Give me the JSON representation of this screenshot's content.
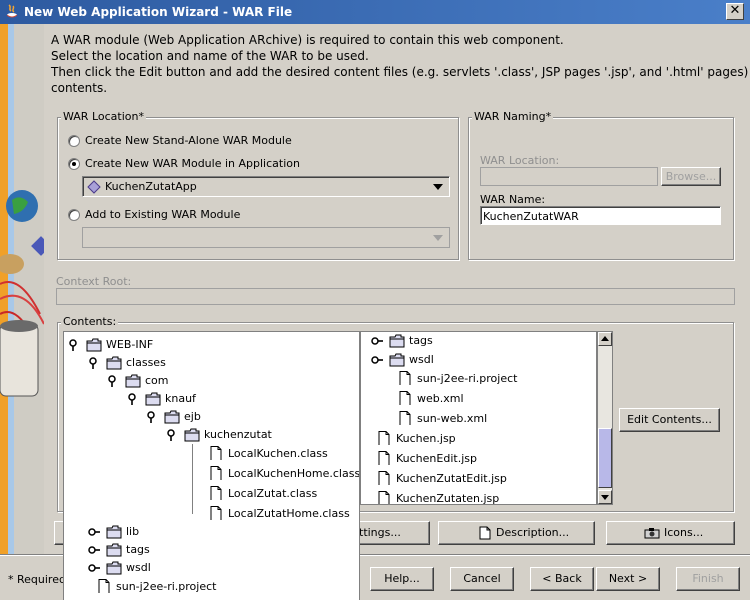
{
  "window": {
    "title": "New Web Application Wizard - WAR File",
    "close_label": "✕"
  },
  "intro": {
    "line1": "A WAR module (Web Application ARchive) is required to contain this web component.",
    "line2": "Select the location and name of the WAR to be used.",
    "line3": "Then click the Edit button and add the desired content files (e.g. servlets '.class', JSP pages '.jsp', and '.html' pages) to its",
    "line4": "contents."
  },
  "war_location": {
    "title": "WAR Location*",
    "option_standalone": "Create New Stand-Alone WAR Module",
    "option_in_app": "Create New WAR Module in Application",
    "app_selected": "KuchenZutatApp",
    "option_existing": "Add to Existing WAR Module",
    "existing_selected": ""
  },
  "war_naming": {
    "title": "WAR Naming*",
    "location_label": "WAR Location:",
    "location_value": "",
    "browse_label": "Browse...",
    "name_label": "WAR Name:",
    "name_value": "KuchenZutatWAR"
  },
  "context_root": {
    "label": "Context Root:",
    "value": ""
  },
  "contents": {
    "label": "Contents:",
    "right_items": [
      {
        "text": "tags",
        "type": "folder"
      },
      {
        "text": "wsdl",
        "type": "folder"
      },
      {
        "text": "sun-j2ee-ri.project",
        "type": "file"
      },
      {
        "text": "web.xml",
        "type": "file"
      },
      {
        "text": "sun-web.xml",
        "type": "file"
      },
      {
        "text": "Kuchen.jsp",
        "type": "file"
      },
      {
        "text": "KuchenEdit.jsp",
        "type": "file"
      },
      {
        "text": "KuchenZutatEdit.jsp",
        "type": "file"
      },
      {
        "text": "KuchenZutaten.jsp",
        "type": "file"
      }
    ],
    "edit_button": "Edit Contents..."
  },
  "popup_tree": [
    {
      "text": "WEB-INF",
      "type": "folder",
      "level": 0,
      "toggle": "open"
    },
    {
      "text": "classes",
      "type": "folder",
      "level": 1,
      "toggle": "open"
    },
    {
      "text": "com",
      "type": "folder",
      "level": 2,
      "toggle": "open"
    },
    {
      "text": "knauf",
      "type": "folder",
      "level": 3,
      "toggle": "open"
    },
    {
      "text": "ejb",
      "type": "folder",
      "level": 4,
      "toggle": "open"
    },
    {
      "text": "kuchenzutat",
      "type": "folder",
      "level": 5,
      "toggle": "open"
    },
    {
      "text": "LocalKuchen.class",
      "type": "file",
      "level": 6
    },
    {
      "text": "LocalKuchenHome.class",
      "type": "file",
      "level": 6
    },
    {
      "text": "LocalZutat.class",
      "type": "file",
      "level": 6
    },
    {
      "text": "LocalZutatHome.class",
      "type": "file",
      "level": 6
    },
    {
      "text": "lib",
      "type": "folder",
      "level": 1,
      "toggle": "closed"
    },
    {
      "text": "tags",
      "type": "folder",
      "level": 1,
      "toggle": "closed"
    },
    {
      "text": "wsdl",
      "type": "folder",
      "level": 1,
      "toggle": "closed"
    },
    {
      "text": "sun-j2ee-ri.project",
      "type": "file",
      "level": 1
    }
  ],
  "lower_buttons": {
    "settings_partial": "ttings...",
    "description": "Description...",
    "icons": "Icons..."
  },
  "footer": {
    "required_note": "* Required",
    "help": "Help...",
    "cancel": "Cancel",
    "back": "< Back",
    "next": "Next >",
    "finish": "Finish"
  }
}
